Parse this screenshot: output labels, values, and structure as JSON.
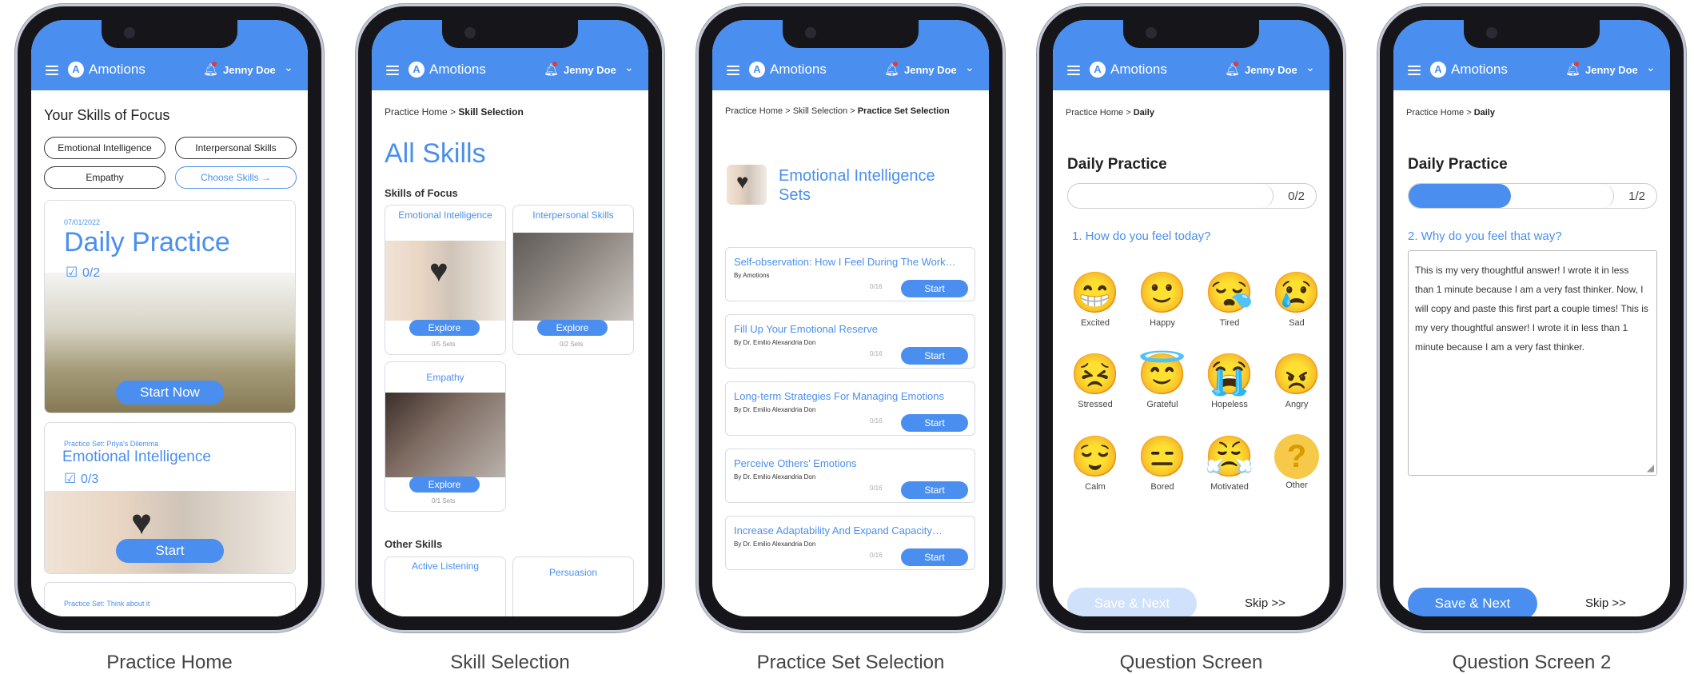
{
  "app": {
    "brand": "Amotions",
    "logo_letter": "A",
    "user": "Jenny Doe",
    "icons": {
      "menu": "hamburger-icon",
      "bell": "bell-icon",
      "chevron": "chevron-down-icon"
    }
  },
  "colors": {
    "accent": "#4a8ff0",
    "alert": "#e53935"
  },
  "captions": [
    "Practice Home",
    "Skill Selection",
    "Practice Set Selection",
    "Question Screen",
    "Question Screen 2"
  ],
  "home": {
    "heading": "Your Skills of Focus",
    "skill_chips": [
      "Emotional Intelligence",
      "Interpersonal Skills",
      "Empathy"
    ],
    "choose_skills": "Choose Skills →",
    "daily": {
      "date": "07/01/2022",
      "title": "Daily Practice",
      "progress": "0/2",
      "cta": "Start Now"
    },
    "set_card": {
      "label": "Practice Set: Priya's Dilemma",
      "title": "Emotional Intelligence",
      "progress": "0/3",
      "cta": "Start"
    },
    "next_card_label": "Practice Set: Think about it"
  },
  "skills": {
    "crumb_home": "Practice Home",
    "crumb_sep": ">",
    "crumb_current": "Skill Selection",
    "title": "All Skills",
    "focus_heading": "Skills of Focus",
    "focus": [
      {
        "name": "Emotional Intelligence",
        "cta": "Explore",
        "sets": "0/5 Sets"
      },
      {
        "name": "Interpersonal Skills",
        "cta": "Explore",
        "sets": "0/2 Sets"
      },
      {
        "name": "Empathy",
        "cta": "Explore",
        "sets": "0/1 Sets"
      }
    ],
    "other_heading": "Other Skills",
    "other": [
      {
        "name": "Active Listening"
      },
      {
        "name": "Persuasion"
      }
    ]
  },
  "sets": {
    "crumb_home": "Practice Home",
    "crumb_mid": "Skill Selection",
    "crumb_current": "Practice Set Selection",
    "title": "Emotional Intelligence Sets",
    "items": [
      {
        "title": "Self-observation: How I Feel During The Work…",
        "author": "By Amotions",
        "progress": "0/16",
        "cta": "Start"
      },
      {
        "title": "Fill Up Your Emotional Reserve",
        "author": "By Dr. Emilio Alexandria Don",
        "progress": "0/16",
        "cta": "Start"
      },
      {
        "title": "Long-term Strategies For Managing Emotions",
        "author": "By Dr. Emilio Alexandria Don",
        "progress": "0/16",
        "cta": "Start"
      },
      {
        "title": "Perceive Others' Emotions",
        "author": "By Dr. Emilio Alexandria Don",
        "progress": "0/16",
        "cta": "Start"
      },
      {
        "title": "Increase Adaptability And Expand Capacity…",
        "author": "By Dr. Emilio Alexandria Don",
        "progress": "0/16",
        "cta": "Start"
      }
    ]
  },
  "question1": {
    "crumb_home": "Practice Home",
    "crumb_current": "Daily",
    "title": "Daily Practice",
    "progress_label": "0/2",
    "progress_fraction": 0,
    "question": "1. How do you feel today?",
    "emotions": [
      {
        "emoji": "😁",
        "label": "Excited"
      },
      {
        "emoji": "🙂",
        "label": "Happy"
      },
      {
        "emoji": "😪",
        "label": "Tired"
      },
      {
        "emoji": "😢",
        "label": "Sad"
      },
      {
        "emoji": "😣",
        "label": "Stressed"
      },
      {
        "emoji": "😇",
        "label": "Grateful"
      },
      {
        "emoji": "😭",
        "label": "Hopeless"
      },
      {
        "emoji": "😠",
        "label": "Angry"
      },
      {
        "emoji": "😌",
        "label": "Calm"
      },
      {
        "emoji": "😑",
        "label": "Bored"
      },
      {
        "emoji": "😤",
        "label": "Motivated"
      },
      {
        "emoji": "?",
        "label": "Other"
      }
    ],
    "save": "Save & Next",
    "skip": "Skip >>"
  },
  "question2": {
    "crumb_home": "Practice Home",
    "crumb_current": "Daily",
    "title": "Daily Practice",
    "progress_label": "1/2",
    "progress_fraction": 0.5,
    "question": "2. Why do you feel that way?",
    "answer": "This is my very thoughtful answer! I wrote it in less than 1 minute because I am a very fast thinker. Now, I will copy and paste this first part a couple times! This is my very thoughtful answer! I wrote it in less than 1 minute because I am a very fast thinker.",
    "save": "Save & Next",
    "skip": "Skip >>"
  }
}
